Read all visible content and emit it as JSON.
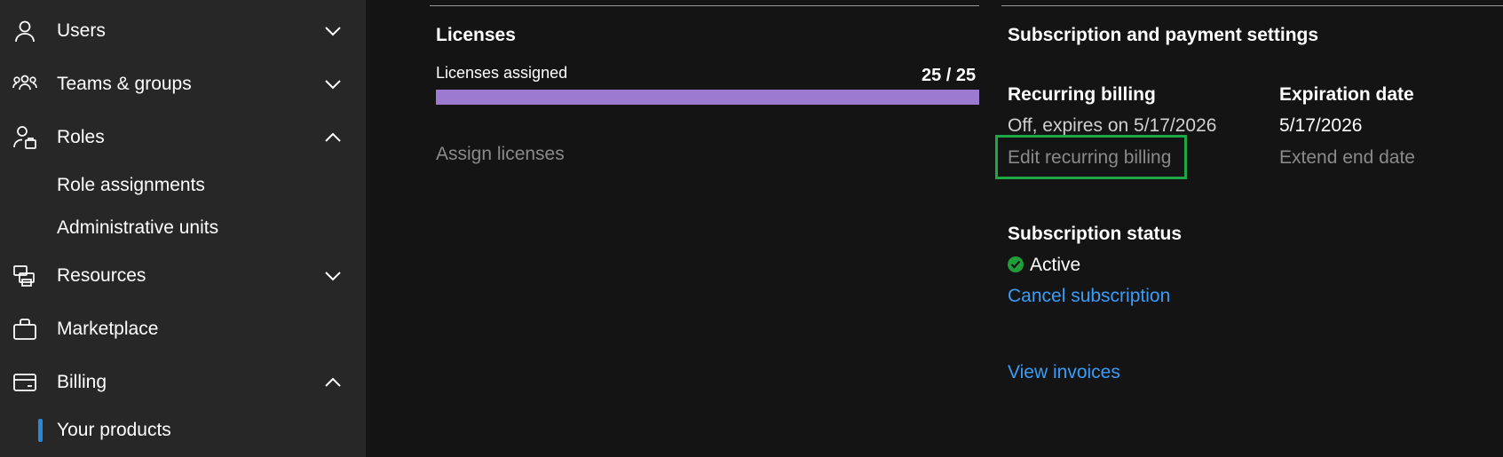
{
  "sidebar": {
    "items": [
      {
        "label": "Users",
        "icon": "person-icon",
        "chevron": "chevron-down"
      },
      {
        "label": "Teams & groups",
        "icon": "people-group-icon",
        "chevron": "chevron-down"
      },
      {
        "label": "Roles",
        "icon": "person-badge-icon",
        "chevron": "chevron-up"
      },
      {
        "label": "Resources",
        "icon": "printer-icon",
        "chevron": "chevron-down"
      },
      {
        "label": "Marketplace",
        "icon": "shopping-bag-icon",
        "chevron": "none"
      },
      {
        "label": "Billing",
        "icon": "credit-card-icon",
        "chevron": "chevron-up"
      }
    ],
    "roles_sub": [
      "Role assignments",
      "Administrative units"
    ],
    "billing_sub": [
      "Your products"
    ]
  },
  "licenses": {
    "title": "Licenses",
    "assigned_label": "Licenses assigned",
    "assigned_count": "25 / 25",
    "assigned_fraction": 1.0,
    "assign_link": "Assign licenses"
  },
  "subscription": {
    "title": "Subscription and payment settings",
    "recurring_billing_title": "Recurring billing",
    "recurring_billing_value": "Off, expires on 5/17/2026",
    "edit_recurring_billing": "Edit recurring billing",
    "expiration_title": "Expiration date",
    "expiration_value": "5/17/2026",
    "extend_end_date": "Extend end date",
    "status_title": "Subscription status",
    "status_value": "Active",
    "cancel_link": "Cancel subscription",
    "invoices_link": "View invoices"
  },
  "colors": {
    "accent_blue": "#3a9cf7",
    "progress": "#9b7ad0",
    "highlight": "#1ea845",
    "active_status": "#1f9d3a"
  }
}
